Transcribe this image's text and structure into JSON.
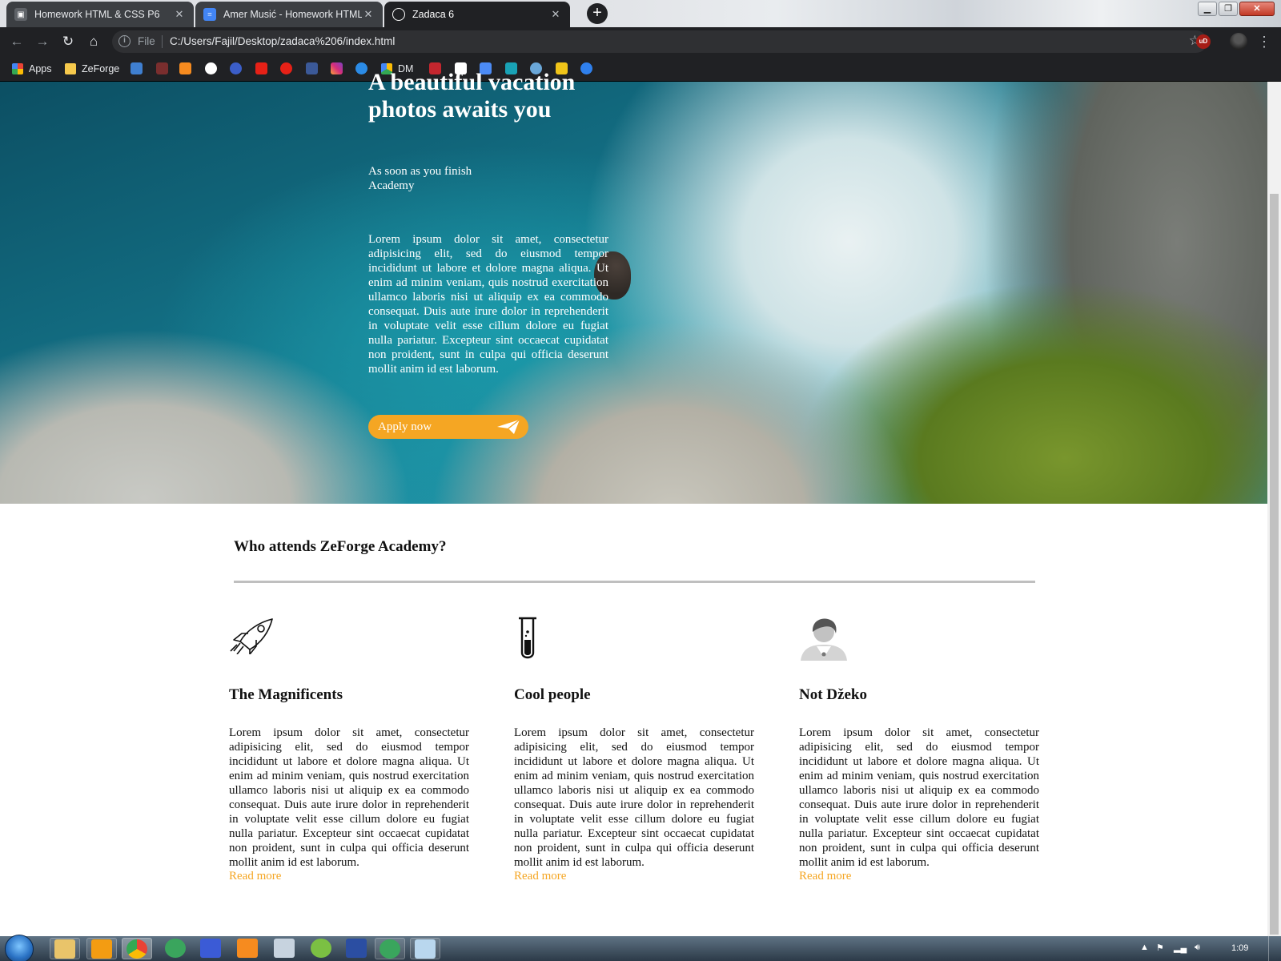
{
  "browser": {
    "tabs": [
      {
        "label": "Homework HTML & CSS P6",
        "active": false
      },
      {
        "label": "Amer Musić - Homework HTML i",
        "active": false
      },
      {
        "label": "Zadaca 6",
        "active": true
      }
    ],
    "address": {
      "scheme_label": "File",
      "url": "C:/Users/Fajil/Desktop/zadaca%206/index.html"
    },
    "bookmarks": [
      {
        "label": "Apps",
        "icon": "apps-grid-icon"
      },
      {
        "label": "ZeForge",
        "icon": "folder-icon"
      },
      {
        "label": "DM",
        "icon": "drive-icon"
      }
    ],
    "extensions": {
      "ublock_label": "uD"
    }
  },
  "page": {
    "hero": {
      "title": "A beautiful vacation photos awaits you",
      "subtitle": "As soon as you finish Academy",
      "body": "Lorem ipsum dolor sit amet, consectetur adipisicing elit, sed do eiusmod tempor incididunt ut labore et dolore magna aliqua. Ut enim ad minim veniam, quis nostrud exercitation ullamco laboris nisi ut aliquip ex ea commodo consequat. Duis aute irure dolor in reprehenderit in voluptate velit esse cillum dolore eu fugiat nulla pariatur. Excepteur sint occaecat cupidatat non proident, sunt in culpa qui officia deserunt mollit anim id est laborum.",
      "cta": "Apply now"
    },
    "section": {
      "title": "Who attends ZeForge Academy?",
      "columns": [
        {
          "heading": "The Magnificents",
          "icon": "rocket-icon",
          "text": "Lorem ipsum dolor sit amet, consectetur adipisicing elit, sed do eiusmod tempor incididunt ut labore et dolore magna aliqua. Ut enim ad minim veniam, quis nostrud exercitation ullamco laboris nisi ut aliquip ex ea commodo consequat. Duis aute irure dolor in reprehenderit in voluptate velit esse cillum dolore eu fugiat nulla pariatur. Excepteur sint occaecat cupidatat non proident, sunt in culpa qui officia deserunt mollit anim id est laborum.",
          "link": "Read more"
        },
        {
          "heading": "Cool people",
          "icon": "test-tube-icon",
          "text": "Lorem ipsum dolor sit amet, consectetur adipisicing elit, sed do eiusmod tempor incididunt ut labore et dolore magna aliqua. Ut enim ad minim veniam, quis nostrud exercitation ullamco laboris nisi ut aliquip ex ea commodo consequat. Duis aute irure dolor in reprehenderit in voluptate velit esse cillum dolore eu fugiat nulla pariatur. Excepteur sint occaecat cupidatat non proident, sunt in culpa qui officia deserunt mollit anim id est laborum.",
          "link": "Read more"
        },
        {
          "heading": "Not Džeko",
          "icon": "doctor-avatar-icon",
          "text": "Lorem ipsum dolor sit amet, consectetur adipisicing elit, sed do eiusmod tempor incididunt ut labore et dolore magna aliqua. Ut enim ad minim veniam, quis nostrud exercitation ullamco laboris nisi ut aliquip ex ea commodo consequat. Duis aute irure dolor in reprehenderit in voluptate velit esse cillum dolore eu fugiat nulla pariatur. Excepteur sint occaecat cupidatat non proident, sunt in culpa qui officia deserunt mollit anim id est laborum.",
          "link": "Read more"
        }
      ]
    }
  },
  "taskbar": {
    "clock": "1:09"
  },
  "colors": {
    "accent": "#f5a623",
    "card_bar": "#add8e6",
    "chrome_dark": "#202124"
  }
}
